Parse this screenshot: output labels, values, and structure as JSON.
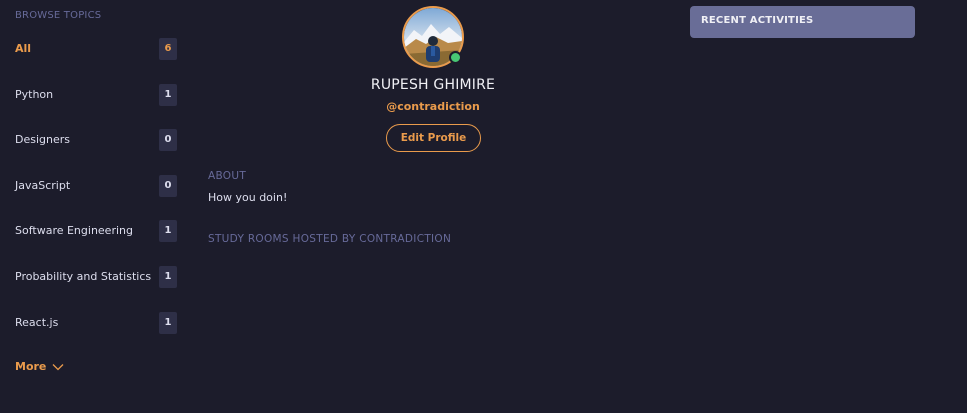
{
  "sidebar": {
    "heading": "BROWSE TOPICS",
    "items": [
      {
        "label": "All",
        "count": "6"
      },
      {
        "label": "Python",
        "count": "1"
      },
      {
        "label": "Designers",
        "count": "0"
      },
      {
        "label": "JavaScript",
        "count": "0"
      },
      {
        "label": "Software Engineering",
        "count": "1"
      },
      {
        "label": "Probability and Statistics",
        "count": "1"
      },
      {
        "label": "React.js",
        "count": "1"
      }
    ],
    "more_label": "More",
    "more_icon": "chevron-down-icon"
  },
  "profile": {
    "name": "RUPESH GHIMIRE",
    "username": "@contradiction",
    "edit_label": "Edit Profile",
    "status": "online",
    "about_heading": "ABOUT",
    "about_text": "How you doin!",
    "rooms_heading": "STUDY ROOMS HOSTED BY CONTRADICTION"
  },
  "recent": {
    "title": "RECENT ACTIVITIES"
  },
  "colors": {
    "background": "#1c1c2b",
    "accent": "#ea9b4c",
    "muted": "#676a99",
    "panel": "#696d97",
    "online": "#48c774"
  }
}
